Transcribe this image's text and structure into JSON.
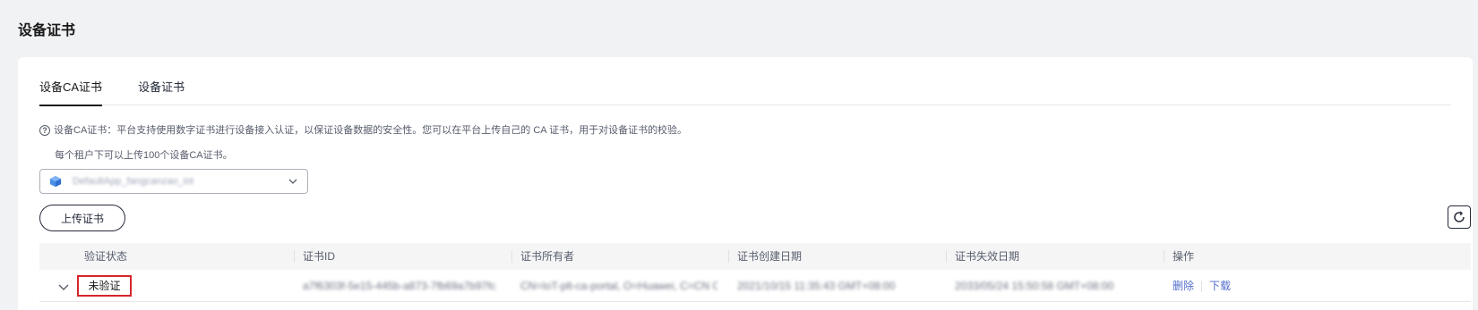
{
  "page": {
    "title": "设备证书"
  },
  "tabs": [
    {
      "label": "设备CA证书",
      "active": true
    },
    {
      "label": "设备证书",
      "active": false
    }
  ],
  "notice": {
    "line1": "设备CA证书：平台支持使用数字证书进行设备接入认证，以保证设备数据的安全性。您可以在平台上传自己的 CA 证书，用于对设备证书的校验。",
    "line2": "每个租户下可以上传100个设备CA证书。"
  },
  "instance_select": {
    "value": "DefaultApp_fangcanzao_iot"
  },
  "toolbar": {
    "upload_label": "上传证书"
  },
  "table": {
    "columns": [
      "验证状态",
      "证书ID",
      "证书所有者",
      "证书创建日期",
      "证书失效日期",
      "操作"
    ],
    "rows": [
      {
        "status": "未验证",
        "cert_id": "a7f6303f-5e15-445b-a873-7fb69a7b97fc",
        "owner": "CN=IoT-plt-ca-portal, O=Huawei, C=CN C...",
        "created": "2021/10/15 11:35:43 GMT+08:00",
        "expires": "2033/05/24 15:50:58 GMT+08:00",
        "actions": {
          "delete": "删除",
          "download": "下载"
        }
      }
    ]
  },
  "colors": {
    "accent": "#526ecc",
    "highlight": "#d4262b",
    "cube": "#4a8fe8"
  }
}
